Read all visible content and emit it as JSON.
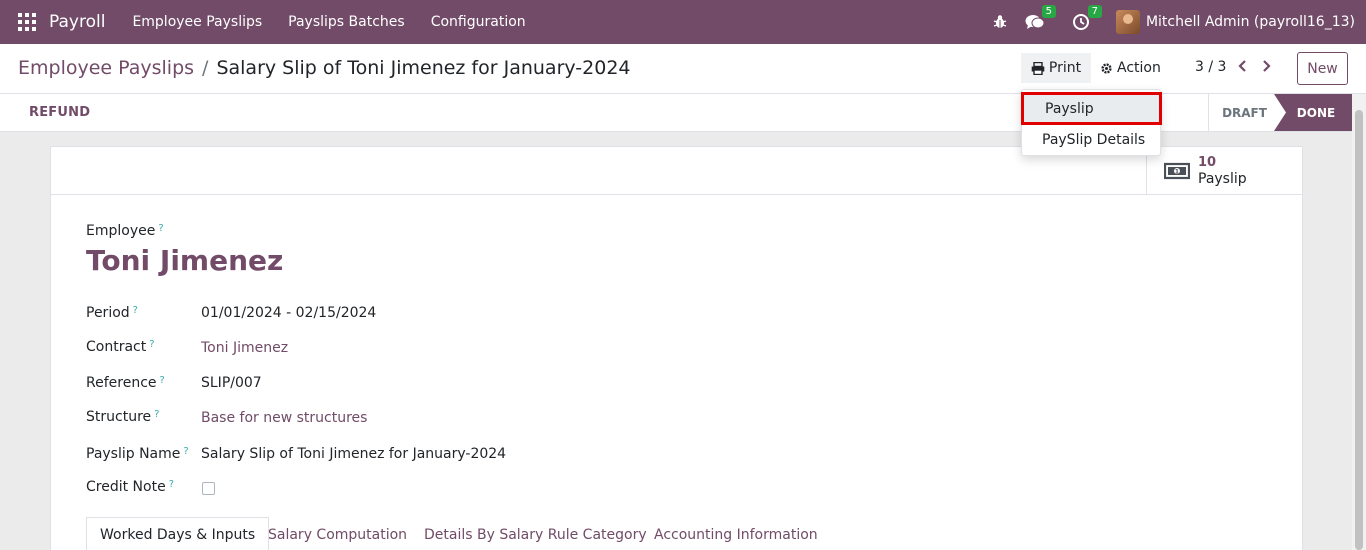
{
  "navbar": {
    "brand": "Payroll",
    "menu": [
      "Employee Payslips",
      "Payslips Batches",
      "Configuration"
    ],
    "messages_count": "5",
    "activities_count": "7",
    "user": "Mitchell Admin (payroll16_13)"
  },
  "breadcrumb": {
    "parent": "Employee Payslips",
    "separator": "/",
    "current": "Salary Slip of Toni Jimenez for January-2024"
  },
  "toolbar": {
    "print_label": "Print",
    "action_label": "Action",
    "pager": "3 / 3",
    "new_label": "New"
  },
  "print_menu": {
    "items": [
      "Payslip",
      "PaySlip Details"
    ]
  },
  "status_bar": {
    "refund_label": "REFUND",
    "stages": [
      "DRAFT",
      "DONE"
    ],
    "current_stage": "DONE"
  },
  "smart_button": {
    "value": "10",
    "label": "Payslip"
  },
  "form": {
    "employee_label": "Employee",
    "employee_name": "Toni Jimenez",
    "help_mark": "?",
    "fields": [
      {
        "label": "Period",
        "value": "01/01/2024 - 02/15/2024"
      },
      {
        "label": "Contract",
        "value": "Toni Jimenez"
      },
      {
        "label": "Reference",
        "value": "SLIP/007"
      },
      {
        "label": "Structure",
        "value": "Base for new structures"
      },
      {
        "label": "Payslip Name",
        "value": "Salary Slip of Toni Jimenez for January-2024"
      },
      {
        "label": "Credit Note",
        "value": ""
      }
    ],
    "credit_note_checked": false
  },
  "tabs": [
    "Worked Days & Inputs",
    "Salary Computation",
    "Details By Salary Rule Category",
    "Accounting Information"
  ],
  "active_tab": "Worked Days & Inputs",
  "colors": {
    "brand": "#714b67",
    "badge": "#28a745",
    "highlight_border": "#e00000",
    "help": "#3aadaa"
  }
}
